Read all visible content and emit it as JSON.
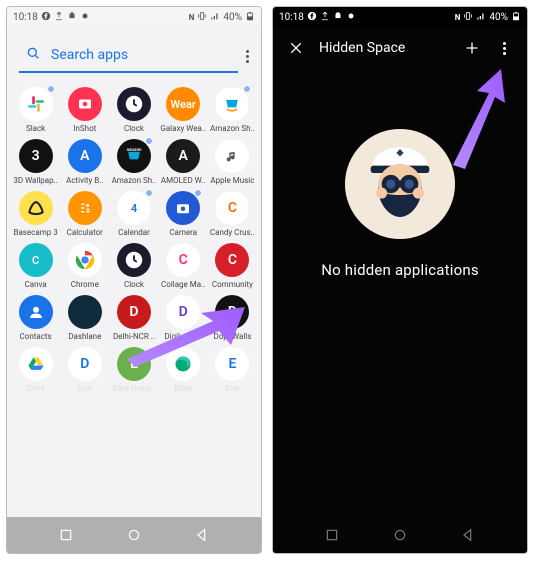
{
  "status_left": {
    "time": "10:18",
    "icons": [
      "facebook-icon",
      "upload-icon",
      "android-icon",
      "camera-icon"
    ]
  },
  "status_right": {
    "icons": [
      "nfc-icon",
      "vibrate-icon",
      "wifi-icon",
      "signal-icon"
    ],
    "battery": "40%"
  },
  "drawer": {
    "search_placeholder": "Search apps",
    "apps": [
      {
        "id": "slack",
        "label": "Slack",
        "bg": "#fff",
        "fg": "#611f69",
        "dot": true
      },
      {
        "id": "inshot",
        "label": "InShot",
        "bg": "#ff3252",
        "fg": "#fff"
      },
      {
        "id": "clock",
        "label": "Clock",
        "bg": "#1b1b2e",
        "fg": "#fff"
      },
      {
        "id": "galaxy-wearable",
        "label": "Galaxy Wea..",
        "bg": "#ff8a00",
        "fg": "#fff",
        "text": "Wear"
      },
      {
        "id": "amazon-shopping",
        "label": "Amazon Sh..",
        "bg": "#fff",
        "fg": "#06a7e0",
        "dot": true
      },
      {
        "id": "3d-wallpaper",
        "label": "3D Wallpap..",
        "bg": "#111",
        "fg": "#fff"
      },
      {
        "id": "activity-bubbles",
        "label": "Activity B..",
        "bg": "#1a73e8",
        "fg": "#fff"
      },
      {
        "id": "amazon-shopping-2",
        "label": "Amazon Sh..",
        "bg": "#111",
        "fg": "#fff",
        "dot": true
      },
      {
        "id": "amoled-wallpapers",
        "label": "AMOLED W..",
        "bg": "#1b1b1b",
        "fg": "#fff"
      },
      {
        "id": "apple-music",
        "label": "Apple Music",
        "bg": "#fff",
        "fg": "#333"
      },
      {
        "id": "basecamp",
        "label": "Basecamp 3",
        "bg": "#ffe14d",
        "fg": "#222"
      },
      {
        "id": "calculator",
        "label": "Calculator",
        "bg": "#ff9500",
        "fg": "#fff"
      },
      {
        "id": "calendar",
        "label": "Calendar",
        "bg": "#fff",
        "fg": "#1a73e8",
        "text": "4",
        "dot": true
      },
      {
        "id": "camera",
        "label": "Camera",
        "bg": "#2159d6",
        "fg": "#fff",
        "dot": true
      },
      {
        "id": "candy-crush",
        "label": "Candy Crus..",
        "bg": "#fff",
        "fg": "#ff6b00"
      },
      {
        "id": "canva",
        "label": "Canva",
        "bg": "#18bdc9",
        "fg": "#fff",
        "text": "C"
      },
      {
        "id": "chrome",
        "label": "Chrome",
        "bg": "#fff",
        "fg": "#555"
      },
      {
        "id": "clock-2",
        "label": "Clock",
        "bg": "#1b1b2e",
        "fg": "#fff"
      },
      {
        "id": "collage-maker",
        "label": "Collage Ma..",
        "bg": "#fff",
        "fg": "#ff2d7a"
      },
      {
        "id": "community",
        "label": "Community",
        "bg": "#d61f26",
        "fg": "#fff"
      },
      {
        "id": "contacts",
        "label": "Contacts",
        "bg": "#1a73e8",
        "fg": "#fff"
      },
      {
        "id": "dashlane",
        "label": "Dashlane",
        "bg": "#0e2b3d",
        "fg": "#18e0b4"
      },
      {
        "id": "delhi-ncr",
        "label": "Delhi-NCR ..",
        "bg": "#c71b1b",
        "fg": "#fff"
      },
      {
        "id": "digilocker",
        "label": "DigiLocker",
        "bg": "#fff",
        "fg": "#6a3bd1"
      },
      {
        "id": "dopewalls",
        "label": "DopeWalls",
        "bg": "#111",
        "fg": "#fff"
      },
      {
        "id": "drive",
        "label": "Drive",
        "bg": "#fff",
        "fg": "#0f9d58"
      },
      {
        "id": "duo",
        "label": "Duo",
        "bg": "#fff",
        "fg": "#1a73e8"
      },
      {
        "id": "easy-uninstaller",
        "label": "Easy Unins..",
        "bg": "#6ab04c",
        "fg": "#fff"
      },
      {
        "id": "edge",
        "label": "Edge",
        "bg": "#fff",
        "fg": "#0a7"
      },
      {
        "id": "evie",
        "label": "Evie",
        "bg": "#fff",
        "fg": "#1a73e8"
      }
    ]
  },
  "hidden": {
    "title": "Hidden Space",
    "message": "No hidden applications"
  },
  "nav": {
    "recents": "recents",
    "home": "home",
    "back": "back"
  }
}
